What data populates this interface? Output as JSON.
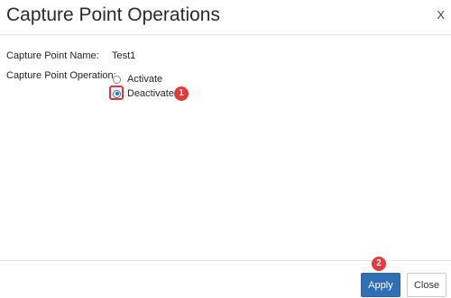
{
  "dialog": {
    "title": "Capture Point Operations",
    "close_label": "X"
  },
  "form": {
    "name_label": "Capture Point Name:",
    "name_value": "Test1",
    "operation_label": "Capture Point Operation:",
    "options": [
      {
        "label": "Activate",
        "selected": false
      },
      {
        "label": "Deactivate",
        "selected": true
      }
    ]
  },
  "annotations": {
    "step1": "1",
    "step2": "2",
    "highlight_color": "#d9363e",
    "badge_color": "#e23b3b"
  },
  "footer": {
    "apply_label": "Apply",
    "close_label": "Close"
  },
  "colors": {
    "primary": "#2f6fb5"
  }
}
